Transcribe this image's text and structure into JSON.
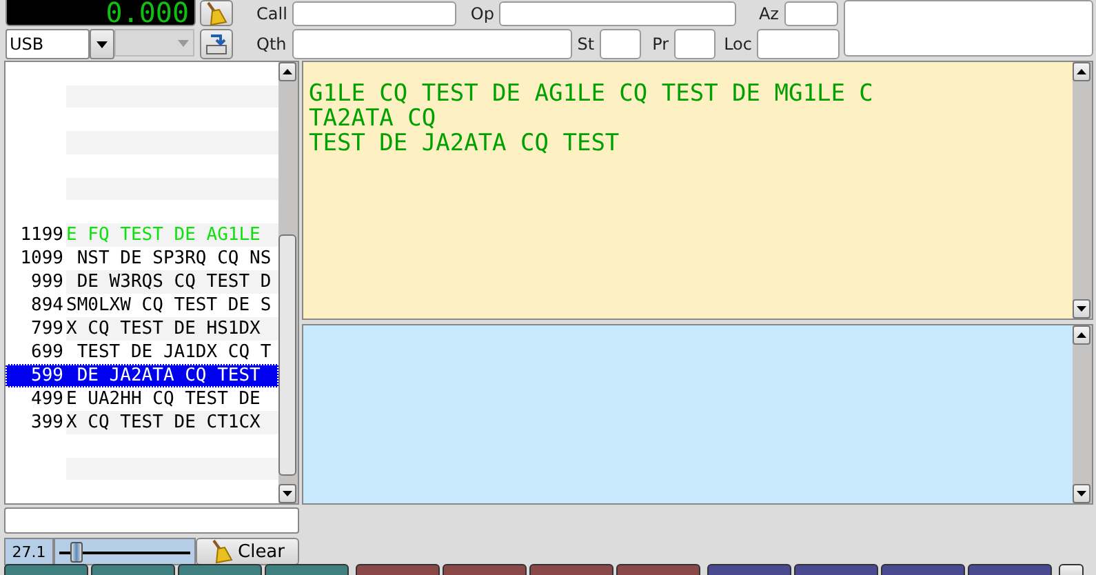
{
  "frequency": "0.000",
  "mode": {
    "value": "USB"
  },
  "fields": {
    "call": {
      "label": "Call"
    },
    "op": {
      "label": "Op"
    },
    "az": {
      "label": "Az"
    },
    "qth": {
      "label": "Qth"
    },
    "st": {
      "label": "St"
    },
    "pr": {
      "label": "Pr"
    },
    "loc": {
      "label": "Loc"
    }
  },
  "browser": {
    "rows": [
      {
        "freq": "1199",
        "text": "E FQ TEST DE AG1LE",
        "highlight": true,
        "selected": false
      },
      {
        "freq": "1099",
        "text": " NST DE SP3RQ CQ NS",
        "highlight": false,
        "selected": false
      },
      {
        "freq": "999",
        "text": " DE W3RQS CQ TEST D",
        "highlight": false,
        "selected": false
      },
      {
        "freq": "894",
        "text": "SM0LXW CQ TEST DE S",
        "highlight": false,
        "selected": false
      },
      {
        "freq": "799",
        "text": "X CQ TEST DE HS1DX ",
        "highlight": false,
        "selected": false
      },
      {
        "freq": "699",
        "text": " TEST DE JA1DX CQ T",
        "highlight": false,
        "selected": false
      },
      {
        "freq": "599",
        "text": " DE JA2ATA CQ TEST ",
        "highlight": false,
        "selected": true
      },
      {
        "freq": "499",
        "text": "E UA2HH CQ TEST DE ",
        "highlight": false,
        "selected": false
      },
      {
        "freq": "399",
        "text": "X CQ TEST DE CT1CX ",
        "highlight": false,
        "selected": false
      }
    ]
  },
  "squelch": {
    "reading": "27.1",
    "level": 0.09
  },
  "clear_button": "Clear",
  "rx_text": [
    "G1LE CQ TEST DE AG1LE CQ TEST DE MG1LE C",
    "TA2ATA CQ",
    "TEST DE JA2ATA CQ TEST"
  ],
  "macro_buttons": [
    {
      "color": "#3f7f7f"
    },
    {
      "color": "#3f7f7f"
    },
    {
      "color": "#3f7f7f"
    },
    {
      "color": "#3f7f7f"
    },
    {
      "color": "#8a4848"
    },
    {
      "color": "#8a4848"
    },
    {
      "color": "#8a4848"
    },
    {
      "color": "#8a4848"
    },
    {
      "color": "#4a4a90"
    },
    {
      "color": "#4a4a90"
    },
    {
      "color": "#4a4a90"
    },
    {
      "color": "#4a4a90"
    }
  ]
}
